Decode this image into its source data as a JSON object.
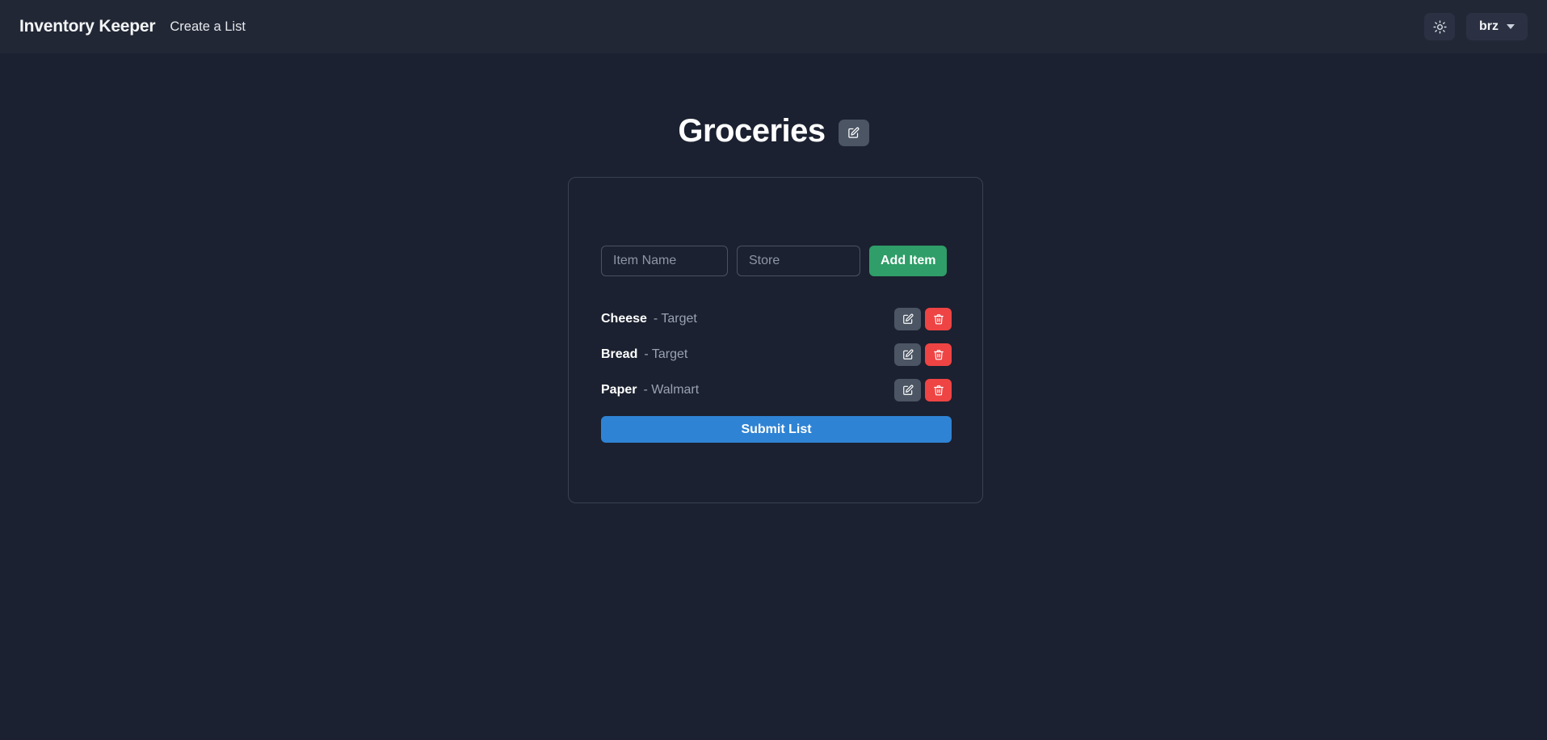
{
  "navbar": {
    "brand": "Inventory Keeper",
    "create_list_link": "Create a List",
    "theme_toggle_icon": "sun-icon",
    "user_menu_label": "brz",
    "user_menu_caret_icon": "chevron-down-icon"
  },
  "page": {
    "title": "Groceries",
    "title_edit_icon": "edit-pencil-square-icon"
  },
  "add_form": {
    "item_name_placeholder": "Item Name",
    "item_name_value": "",
    "store_placeholder": "Store",
    "store_value": "",
    "add_button_label": "Add Item"
  },
  "items": [
    {
      "name": "Cheese",
      "store": "- Target",
      "edit_icon": "edit-pencil-square-icon",
      "delete_icon": "trash-icon"
    },
    {
      "name": "Bread",
      "store": "- Target",
      "edit_icon": "edit-pencil-square-icon",
      "delete_icon": "trash-icon"
    },
    {
      "name": "Paper",
      "store": "- Walmart",
      "edit_icon": "edit-pencil-square-icon",
      "delete_icon": "trash-icon"
    }
  ],
  "submit": {
    "label": "Submit List"
  },
  "colors": {
    "page_background": "#1b2130",
    "navbar_background": "#212735",
    "card_border": "#3a4152",
    "add_item_green": "#2f9e68",
    "submit_blue": "#2f83d4",
    "delete_red": "#ef4444",
    "edit_gray": "#4b5563",
    "text_primary": "#ffffff",
    "text_muted": "#9aa2b1"
  }
}
